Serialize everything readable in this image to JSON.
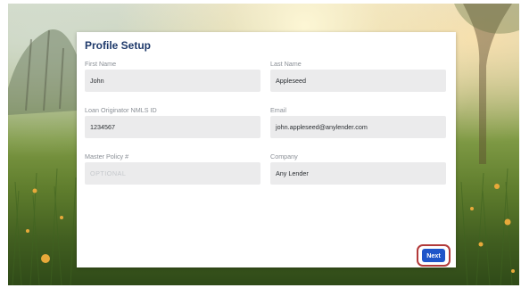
{
  "card": {
    "title": "Profile Setup"
  },
  "fields": {
    "first_name": {
      "label": "First Name",
      "value": "John"
    },
    "last_name": {
      "label": "Last Name",
      "value": "Appleseed"
    },
    "nmls_id": {
      "label": "Loan Originator NMLS ID",
      "value": "1234567"
    },
    "email": {
      "label": "Email",
      "value": "john.appleseed@anylender.com"
    },
    "master_policy": {
      "label": "Master Policy #",
      "value": "",
      "placeholder": "OPTIONAL"
    },
    "company": {
      "label": "Company",
      "value": "Any Lender"
    }
  },
  "actions": {
    "next_label": "Next"
  },
  "colors": {
    "title": "#1f3a6b",
    "field_bg": "#ebebec",
    "button": "#1f55c9",
    "highlight_ring": "#b23a3a"
  }
}
